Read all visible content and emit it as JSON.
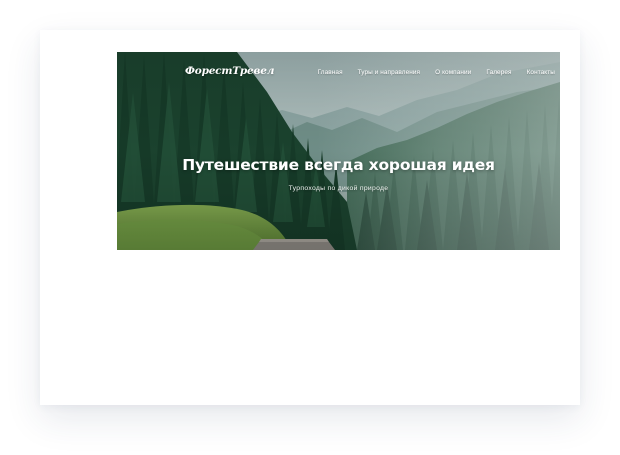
{
  "site": {
    "logo": "ФорестТревел",
    "nav": [
      {
        "label": "Главная"
      },
      {
        "label": "Туры и направления"
      },
      {
        "label": "О компании"
      },
      {
        "label": "Галерея"
      },
      {
        "label": "Контакты"
      }
    ]
  },
  "hero": {
    "title": "Путешествие всегда хорошая идея",
    "subtitle": "Турпоходы по дикой природе"
  },
  "colors": {
    "page_background": "#ffffff",
    "forest_dark": "#143824",
    "forest_mid": "#2f5a41",
    "meadow": "#6c9a42",
    "fog": "#a9c0bd"
  }
}
